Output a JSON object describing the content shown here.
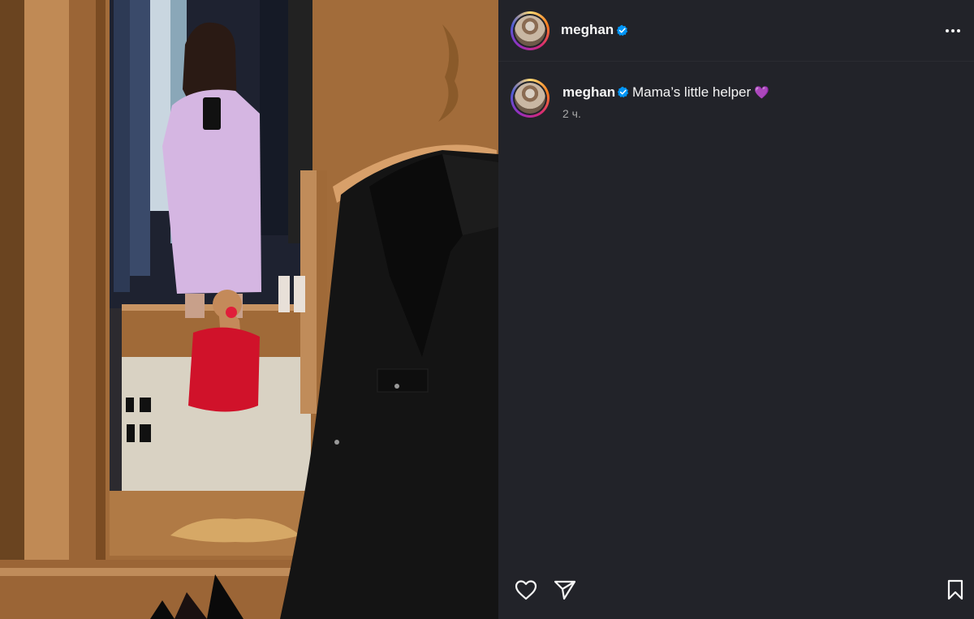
{
  "post": {
    "author": "meghan",
    "verified": true,
    "caption": {
      "username": "meghan",
      "text": "Mama’s little helper",
      "emoji": "💜"
    },
    "timestamp": "2 ч."
  },
  "icons": {
    "more": "more-options-icon",
    "like": "heart-icon",
    "share": "paper-plane-icon",
    "save": "bookmark-icon",
    "verified": "verified-badge-icon"
  },
  "colors": {
    "panel_bg": "#222329",
    "text": "#f5f5f5",
    "muted": "#a8a8a8",
    "verified_blue": "#0095f6"
  }
}
